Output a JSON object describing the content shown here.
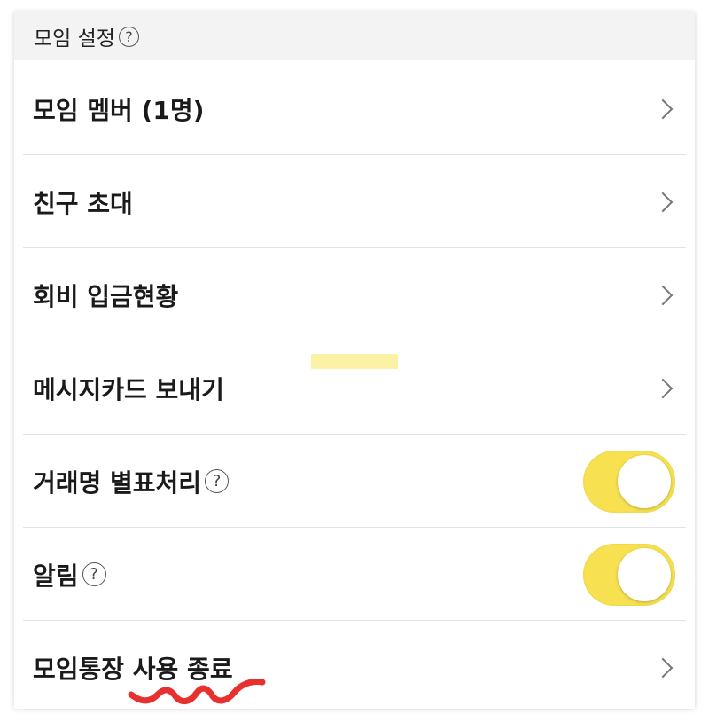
{
  "header": {
    "title": "모임 설정",
    "help_symbol": "?"
  },
  "rows": [
    {
      "label": "모임 멤버 (1명)",
      "control": "chevron"
    },
    {
      "label": "친구 초대",
      "control": "chevron"
    },
    {
      "label": "회비 입금현황",
      "control": "chevron"
    },
    {
      "label": "메시지카드 보내기",
      "control": "chevron"
    },
    {
      "label": "거래명 별표처리",
      "control": "toggle",
      "help": "?",
      "state": "on"
    },
    {
      "label": "알림",
      "control": "toggle",
      "help": "?",
      "state": "on"
    },
    {
      "label": "모임통장 사용 종료",
      "control": "chevron"
    }
  ],
  "colors": {
    "toggle_on": "#f7e150",
    "header_bg": "#f2f3f2",
    "annotation_red": "#e8312f",
    "highlight_yellow": "#fbf2a6"
  }
}
